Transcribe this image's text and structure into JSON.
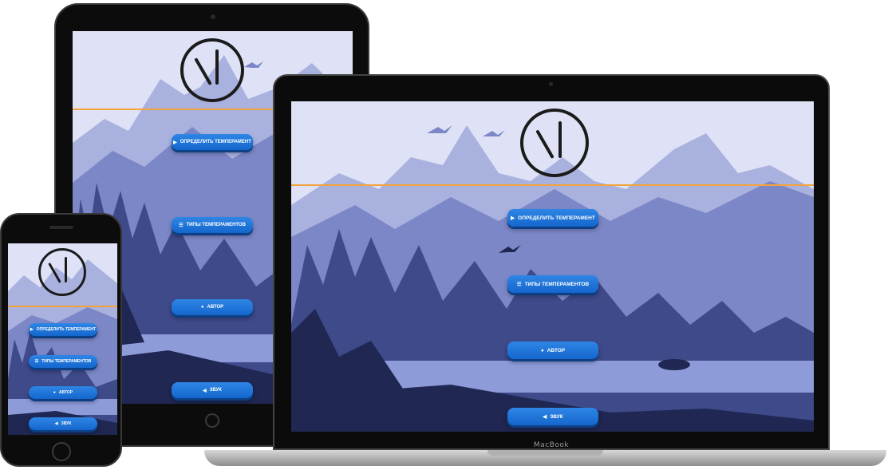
{
  "app": {
    "menu": [
      {
        "key": "start",
        "label": "Определить темперамент",
        "icon": "play-circle-icon"
      },
      {
        "key": "types",
        "label": "Типы темпераментов",
        "icon": "list-icon"
      },
      {
        "key": "author",
        "label": "Автор",
        "icon": "user-icon"
      },
      {
        "key": "sound",
        "label": "Звук",
        "icon": "speaker-icon"
      }
    ]
  },
  "laptop": {
    "brand": "MacBook"
  },
  "colors": {
    "button": "#1f74dc",
    "accent_line": "#f2a33a",
    "sky": "#dfe2f6",
    "mountain_far": "#a9b1de",
    "mountain_mid": "#7b87c7",
    "forest": "#3e4a8a",
    "forest_dark": "#1f2752",
    "lake": "#8d9bd8"
  }
}
